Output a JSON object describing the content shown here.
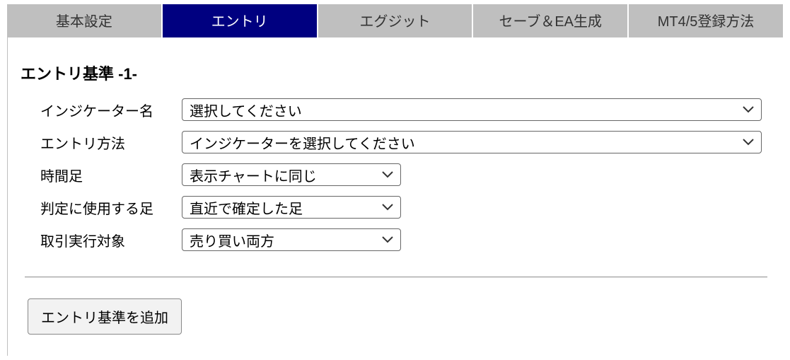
{
  "tabs": [
    {
      "label": "基本設定",
      "active": false
    },
    {
      "label": "エントリ",
      "active": true
    },
    {
      "label": "エグジット",
      "active": false
    },
    {
      "label": "セーブ＆EA生成",
      "active": false
    },
    {
      "label": "MT4/5登録方法",
      "active": false
    }
  ],
  "section_title": "エントリ基準 -1-",
  "rows": {
    "indicator_name": {
      "label": "インジケーター名",
      "value": "選択してください"
    },
    "entry_method": {
      "label": "エントリ方法",
      "value": "インジケーターを選択してください"
    },
    "timeframe": {
      "label": "時間足",
      "value": "表示チャートに同じ"
    },
    "judge_bar": {
      "label": "判定に使用する足",
      "value": "直近で確定した足"
    },
    "trade_target": {
      "label": "取引実行対象",
      "value": "売り買い両方"
    }
  },
  "add_button": "エントリ基準を追加"
}
